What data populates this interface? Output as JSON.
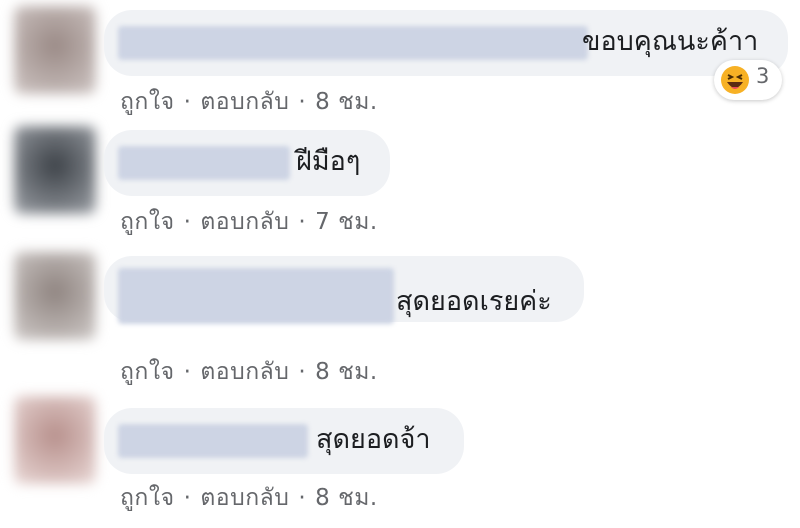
{
  "comments": [
    {
      "text": "ขอบคุณนะค้าา",
      "like": "ถูกใจ",
      "reply": "ตอบกลับ",
      "time": "8 ชม.",
      "reaction": {
        "icon": "haha-emoji-icon",
        "count": "3"
      }
    },
    {
      "text": "ฝีมือๆ",
      "like": "ถูกใจ",
      "reply": "ตอบกลับ",
      "time": "7 ชม."
    },
    {
      "text": "สุดยอดเรยค่ะ",
      "like": "ถูกใจ",
      "reply": "ตอบกลับ",
      "time": "8 ชม."
    },
    {
      "text": "สุดยอดจ้า",
      "like": "ถูกใจ",
      "reply": "ตอบกลับ",
      "time": "8 ชม."
    }
  ],
  "colors": {
    "bubble": "#f0f2f5",
    "meta_text": "#65676b",
    "reaction_yellow": "#f7b125"
  }
}
